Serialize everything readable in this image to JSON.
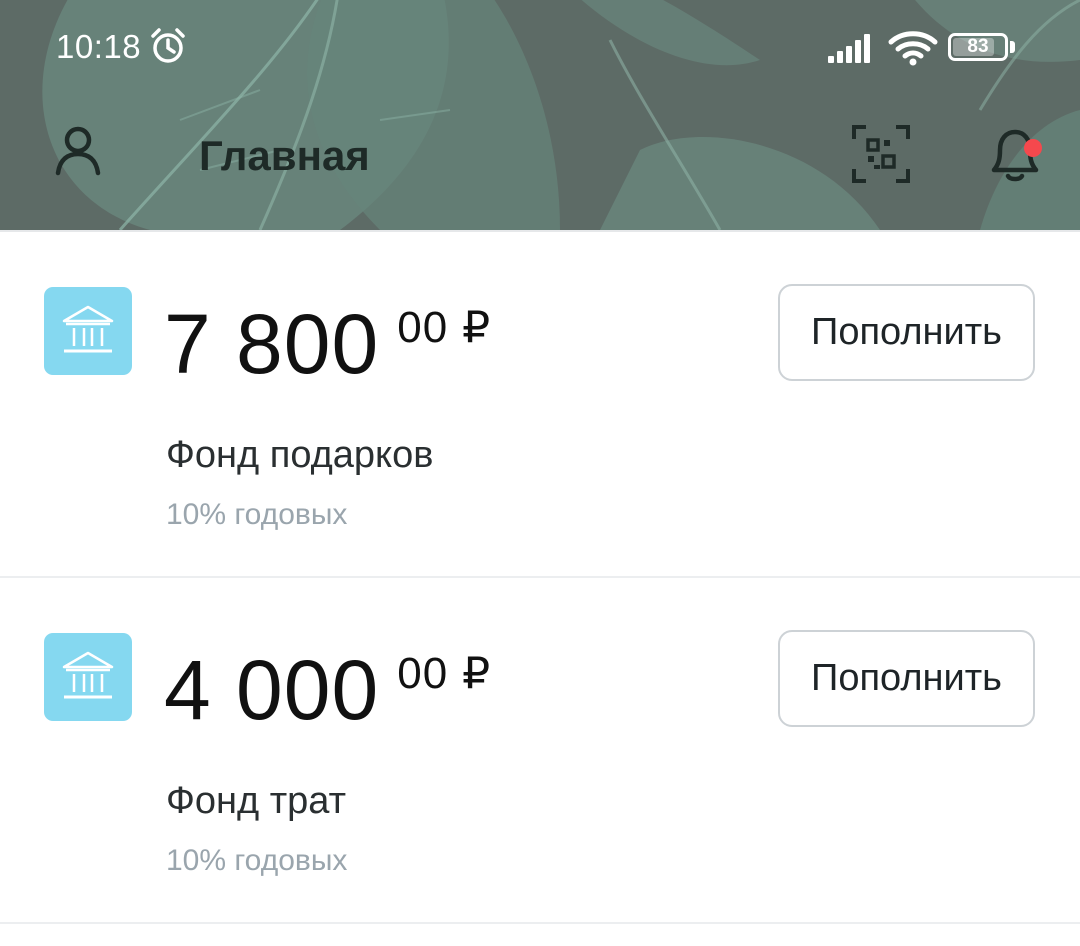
{
  "status_bar": {
    "time": "10:18",
    "battery_percent": "83",
    "battery_level": 0.83
  },
  "header": {
    "title": "Главная",
    "profile_icon": "user-icon",
    "qr_icon": "qr-scan-icon",
    "bell_icon": "bell-icon",
    "notification_dot_color": "#f5484d"
  },
  "funds": [
    {
      "amount_int": "7 800",
      "amount_frac": "00",
      "currency": "₽",
      "name": "Фонд подарков",
      "rate": "10% годовых",
      "button_label": "Пополнить",
      "icon": "bank-icon"
    },
    {
      "amount_int": "4 000",
      "amount_frac": "00",
      "currency": "₽",
      "name": "Фонд трат",
      "rate": "10% годовых",
      "button_label": "Пополнить",
      "icon": "bank-icon"
    }
  ],
  "colors": {
    "icon_tile": "#85d8f0",
    "rate_text": "#9aa5ad",
    "button_border": "#cdd2d6"
  }
}
